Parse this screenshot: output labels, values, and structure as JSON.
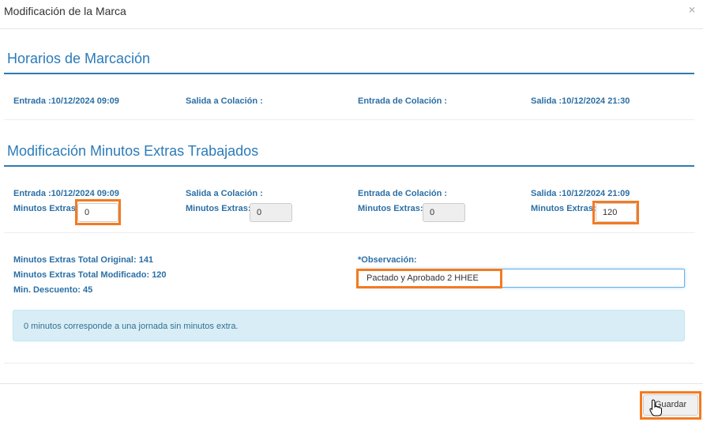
{
  "header": {
    "title": "Modificación de la Marca",
    "close": "×"
  },
  "horarios": {
    "title": "Horarios de Marcación",
    "entrada": "Entrada :10/12/2024 09:09",
    "salida_colacion": "Salida a Colación :",
    "entrada_colacion": "Entrada de Colación :",
    "salida": "Salida :10/12/2024 21:30"
  },
  "modificacion": {
    "title": "Modificación Minutos Extras Trabajados",
    "entrada": "Entrada :10/12/2024 09:09",
    "salida_colacion": "Salida a Colación :",
    "entrada_colacion": "Entrada de Colación :",
    "salida": "Salida :10/12/2024 21:09",
    "minutos_label": "Minutos Extras:",
    "values": [
      "0",
      "0",
      "0",
      "120"
    ]
  },
  "totals": {
    "original": "Minutos Extras Total Original: 141",
    "modificado": "Minutos Extras Total Modificado: 120",
    "descuento": "Min. Descuento: 45"
  },
  "observacion": {
    "label": "*Observación:",
    "value": "Pactado y Aprobado 2 HHEE"
  },
  "alert": {
    "text": "0 minutos corresponde a una jornada sin minutos extra."
  },
  "footer": {
    "save_label": "Guardar"
  },
  "colors": {
    "accent": "#2b7bb9",
    "highlight": "#f47a20",
    "alert_bg": "#d9edf7"
  }
}
